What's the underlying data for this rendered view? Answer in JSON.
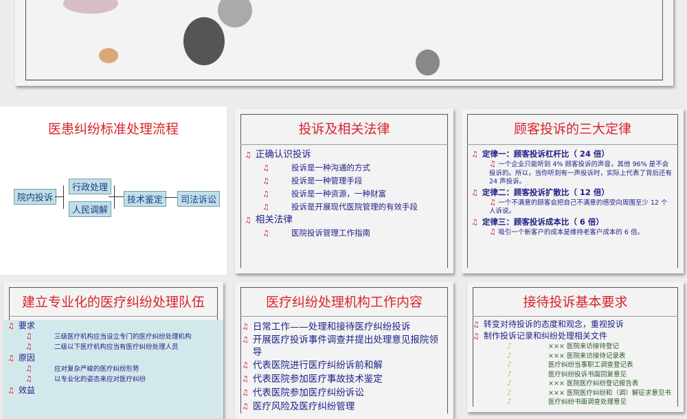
{
  "slides": [
    {
      "title": "医患纠纷标准处理流程",
      "flow": [
        "院内投诉",
        "行政处理",
        "人民调解",
        "技术鉴定",
        "司法诉讼"
      ]
    },
    {
      "title": "投诉及相关法律",
      "items": [
        {
          "text": "正确认识投诉",
          "children": [
            "投诉是一种沟通的方式",
            "投诉是一种管理手段",
            "投诉是一种资源，一种财富",
            "投诉是开展现代医院管理的有效手段"
          ]
        },
        {
          "text": "相关法律",
          "children": [
            "医院投诉管理工作指南"
          ]
        }
      ]
    },
    {
      "title": "顾客投诉的三大定律",
      "items": [
        {
          "text": "定律一：顾客投诉杠杆比（ 24 倍）",
          "children": [
            "一个企业只能听到 4% 顾客投诉的声音，其他 96% 是不会投诉的。所以，当你听到有一声投诉时，实际上代表了背后还有 24 声投诉。"
          ]
        },
        {
          "text": "定律二：顾客投诉扩散比（ 12 倍）",
          "children": [
            "一个不满意的顾客会把自己不满意的感受向周围至少 12 个人诉说。"
          ]
        },
        {
          "text": "定律三：顾客投诉成本比（ 6 倍）",
          "children": [
            "吸引一个新客户的成本是维持老客户成本的 6 倍。"
          ]
        }
      ]
    },
    {
      "title": "建立专业化的医疗纠纷处理队伍",
      "items": [
        {
          "text": "要求",
          "children": [
            "三级医疗机构应当设立专门的医疗纠纷处理机构",
            "二级以下医疗机构应当有医疗纠纷处理人员"
          ]
        },
        {
          "text": "原因",
          "children": [
            "应对复杂严峻的医疗纠纷形势",
            "以专业化的姿态来应对医疗纠纷"
          ]
        },
        {
          "text": "效益",
          "children": []
        }
      ]
    },
    {
      "title": "医疗纠纷处理机构工作内容",
      "items": [
        "日常工作——处理和接待医疗纠纷投诉",
        "开展医疗投诉事件调查并提出处理意见报院领导",
        "代表医院进行医疗纠纷诉前和解",
        "代表医院参加医疗事故技术鉴定",
        "代表医院参加医疗纠纷诉讼",
        "医疗风险及医疗纠纷管理"
      ]
    },
    {
      "title": "接待投诉基本要求",
      "items": [
        "转变对待投诉的态度和观念，重视投诉",
        "制作投诉记录和纠纷处理相关文件"
      ],
      "docs": [
        "××× 医院来访接待登记",
        "××× 医院来访接待记录表",
        "医疗纠纷当事职工调查登记表",
        "医疗纠纷投诉书面回复意见",
        "××× 医院医疗纠纷登记报告表",
        "××× 医院医疗纠纷和（调）解征求意见书",
        "医疗纠纷书面调查处理意见"
      ]
    }
  ],
  "icons": {
    "bullet": "music-note-icon"
  },
  "colors": {
    "title": "#d9232b",
    "text": "#1e1e88",
    "bullet": "#c81e3c"
  }
}
